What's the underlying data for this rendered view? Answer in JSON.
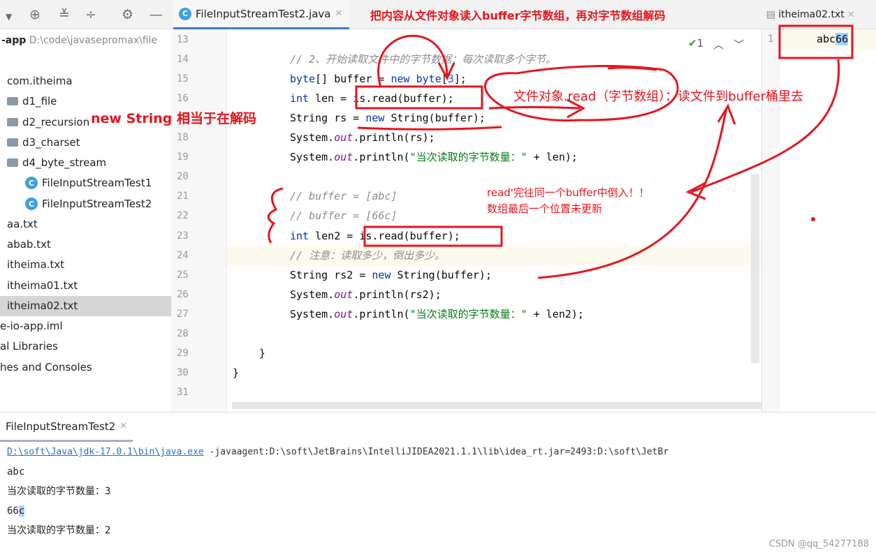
{
  "toolbar": {
    "icons": [
      "chevron-down-icon",
      "target-icon",
      "expand-all-icon",
      "collapse-all-icon",
      "gear-icon",
      "minimize-icon"
    ]
  },
  "tabs": {
    "main": "FileInputStreamTest2.java",
    "right": "itheima02.txt"
  },
  "project": {
    "name": "-app",
    "path": "D:\\code\\javasepromax\\file",
    "items": [
      {
        "label": "com.itheima",
        "type": "package"
      },
      {
        "label": "d1_file",
        "type": "folder"
      },
      {
        "label": "d2_recursion",
        "type": "folder"
      },
      {
        "label": "d3_charset",
        "type": "folder"
      },
      {
        "label": "d4_byte_stream",
        "type": "folder"
      },
      {
        "label": "FileInputStreamTest1",
        "type": "class"
      },
      {
        "label": "FileInputStreamTest2",
        "type": "class"
      },
      {
        "label": "aa.txt",
        "type": "file"
      },
      {
        "label": "abab.txt",
        "type": "file"
      },
      {
        "label": "itheima.txt",
        "type": "file"
      },
      {
        "label": "itheima01.txt",
        "type": "file"
      },
      {
        "label": "itheima02.txt",
        "type": "file",
        "selected": true
      },
      {
        "label": "e-io-app.iml",
        "type": "file"
      },
      {
        "label": "al Libraries",
        "type": "node"
      },
      {
        "label": "hes and Consoles",
        "type": "node"
      }
    ]
  },
  "editor": {
    "inspection_count": "1",
    "lines": [
      {
        "n": "13",
        "tokens": []
      },
      {
        "n": "14",
        "tokens": [
          {
            "t": "// 2、开始读取文件中的字节数据：每次读取多个字节。",
            "c": "cm"
          }
        ]
      },
      {
        "n": "15",
        "tokens": [
          {
            "t": "byte",
            "c": "kw"
          },
          {
            "t": "[] buffer = "
          },
          {
            "t": "new",
            "c": "kw"
          },
          {
            "t": " "
          },
          {
            "t": "byte",
            "c": "kw"
          },
          {
            "t": "["
          },
          {
            "t": "3",
            "c": "num"
          },
          {
            "t": "];"
          }
        ]
      },
      {
        "n": "16",
        "tokens": [
          {
            "t": "int",
            "c": "kw"
          },
          {
            "t": " len = is.read(buffer);"
          }
        ]
      },
      {
        "n": "17",
        "tokens": [
          {
            "t": "String rs = "
          },
          {
            "t": "new",
            "c": "kw"
          },
          {
            "t": " String(buffer);"
          }
        ]
      },
      {
        "n": "18",
        "tokens": [
          {
            "t": "System."
          },
          {
            "t": "out",
            "c": "fd"
          },
          {
            "t": ".println(rs);"
          }
        ]
      },
      {
        "n": "19",
        "tokens": [
          {
            "t": "System."
          },
          {
            "t": "out",
            "c": "fd"
          },
          {
            "t": ".println("
          },
          {
            "t": "\"当次读取的字节数量：\"",
            "c": "st"
          },
          {
            "t": " + len);"
          }
        ]
      },
      {
        "n": "20",
        "tokens": []
      },
      {
        "n": "21",
        "tokens": [
          {
            "t": "// buffer = [abc]",
            "c": "cm"
          }
        ]
      },
      {
        "n": "22",
        "tokens": [
          {
            "t": "// buffer = [66c]",
            "c": "cm"
          }
        ]
      },
      {
        "n": "23",
        "tokens": [
          {
            "t": "int",
            "c": "kw"
          },
          {
            "t": " len2 = is.read(buffer);"
          }
        ]
      },
      {
        "n": "24",
        "tokens": [
          {
            "t": "// 注意：读取多少，倒出多少。",
            "c": "cm"
          }
        ]
      },
      {
        "n": "25",
        "tokens": [
          {
            "t": "String rs2 = "
          },
          {
            "t": "new",
            "c": "kw"
          },
          {
            "t": " String(buffer);"
          }
        ]
      },
      {
        "n": "26",
        "tokens": [
          {
            "t": "System."
          },
          {
            "t": "out",
            "c": "fd"
          },
          {
            "t": ".println(rs2);"
          }
        ]
      },
      {
        "n": "27",
        "tokens": [
          {
            "t": "System."
          },
          {
            "t": "out",
            "c": "fd"
          },
          {
            "t": ".println("
          },
          {
            "t": "\"当次读取的字节数量：\"",
            "c": "st"
          },
          {
            "t": " + len2);"
          }
        ]
      },
      {
        "n": "28",
        "tokens": []
      },
      {
        "n": "29",
        "tokens": [
          {
            "t": "}",
            "indent": 1
          }
        ]
      },
      {
        "n": "30",
        "tokens": [
          {
            "t": "}",
            "indent": 0
          }
        ]
      },
      {
        "n": "31",
        "tokens": []
      }
    ]
  },
  "right_editor": {
    "line": "1",
    "content_plain": "abc",
    "content_selected": "66"
  },
  "console": {
    "tab": "FileInputStreamTest2",
    "command_link": "D:\\soft\\Java\\jdk-17.0.1\\bin\\java.exe",
    "command_rest": " -javaagent:D:\\soft\\JetBrains\\IntelliJIDEA2021.1.1\\lib\\idea_rt.jar=2493:D:\\soft\\JetBr",
    "out1": "abc",
    "out2": "当次读取的字节数量：3",
    "out3_plain": "66",
    "out3_selected": "c",
    "out4": "当次读取的字节数量：2"
  },
  "annotations": {
    "top": "把内容从文件对象读入buffer字节数组，再对字节数组解码",
    "new_string": "new String 相当于在解码",
    "read_desc": "文件对象.read（字节数组）：读文件到buffer桶里去",
    "note1": "read'完往同一个buffer中倒入！！",
    "note2": "数组最后一个位置未更新"
  },
  "watermark": "CSDN @qq_54277188",
  "colors": {
    "annotation": "#e8141c",
    "keyword": "#0033b3",
    "comment": "#8c8c8c",
    "string": "#067d17",
    "selection": "#a6d2ff"
  }
}
